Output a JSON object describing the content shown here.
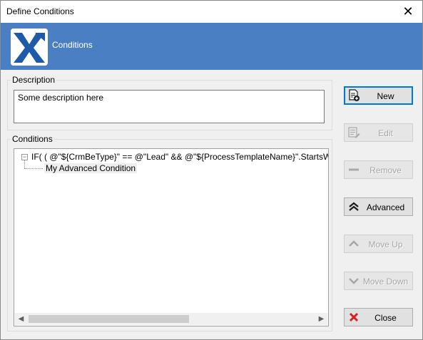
{
  "window": {
    "title": "Define Conditions",
    "close_glyph": "✕"
  },
  "banner": {
    "title": "Conditions",
    "logo_icon": "x-logo-icon",
    "color": "#4a7fc4"
  },
  "description": {
    "group_label": "Description",
    "value": "Some description here"
  },
  "conditions": {
    "group_label": "Conditions",
    "tree": [
      {
        "expander": "−",
        "text": "IF( ( @\"${CrmBeType}\" == @\"Lead\"   &&   @\"${ProcessTemplateName}\".StartsW",
        "children": [
          {
            "text": "My Advanced Condition"
          }
        ]
      }
    ],
    "scroll_left": "◀",
    "scroll_right": "▶"
  },
  "buttons": {
    "new": {
      "label": "New",
      "icon": "new-document-icon",
      "enabled": true
    },
    "edit": {
      "label": "Edit",
      "icon": "edit-list-icon",
      "enabled": false
    },
    "remove": {
      "label": "Remove",
      "icon": "minus-icon",
      "enabled": false
    },
    "advanced": {
      "label": "Advanced",
      "icon": "double-chevron-up-icon",
      "enabled": true
    },
    "move_up": {
      "label": "Move Up",
      "icon": "chevron-up-icon",
      "enabled": false
    },
    "move_down": {
      "label": "Move Down",
      "icon": "chevron-down-icon",
      "enabled": false
    },
    "close": {
      "label": "Close",
      "icon": "red-x-icon",
      "enabled": true
    }
  }
}
